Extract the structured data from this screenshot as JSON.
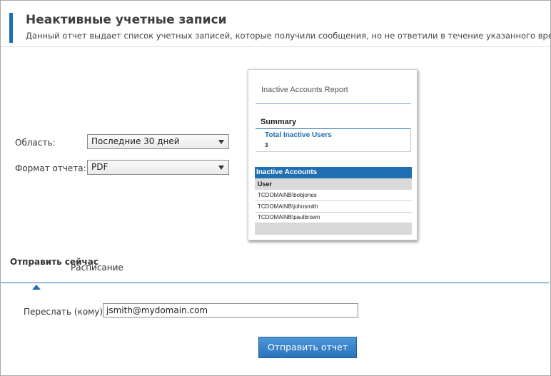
{
  "header": {
    "title": "Неактивные учетные записи",
    "subtitle": "Данный отчет выдает список учетных записей, которые получили сообщения, но не ответили в течение указанного времени."
  },
  "form": {
    "scope_label": "Область:",
    "scope_value": "Последние 30 дней",
    "format_label": "Формат отчета:",
    "format_value": "PDF"
  },
  "preview": {
    "title": "Inactive Accounts Report",
    "summary_heading": "Summary",
    "total_label": "Total Inactive Users",
    "total_value": "3",
    "section_heading": "Inactive Accounts",
    "column_header": "User",
    "rows": [
      "TCDOMAINB\\bobjones",
      "TCDOMAINB\\johnsmith",
      "TCDOMAINB\\paulbrown"
    ]
  },
  "tabs": {
    "send_now": "Отправить сейчас",
    "schedule": "Расписание"
  },
  "send": {
    "forward_label": "Переслать (кому):",
    "email_value": "jsmith@mydomain.com",
    "button_label": "Отправить отчет"
  },
  "colors": {
    "accent": "#1f6fb2"
  }
}
